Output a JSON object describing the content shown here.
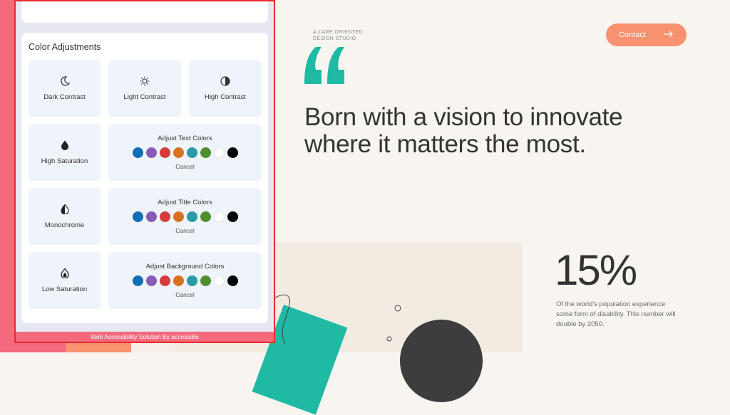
{
  "site": {
    "eyebrow_line1": "A CARE ORIENTED",
    "eyebrow_line2": "DESIGN STUDIO",
    "contact_label": "Contact",
    "headline_line1": "Born with a vision to innovate",
    "headline_line2": "where it matters the most.",
    "stat_value": "15%",
    "stat_text": "Of the world's population experience some form of disability. This number will double by 2050.",
    "colors": {
      "accent": "#f8916f",
      "teal": "#20b9a4",
      "pink": "#f36a7d",
      "text": "#333333"
    }
  },
  "panel": {
    "title": "Color Adjustments",
    "tiles": {
      "dark_contrast": {
        "label": "Dark Contrast",
        "icon": "moon-icon"
      },
      "light_contrast": {
        "label": "Light Contrast",
        "icon": "sun-icon"
      },
      "high_contrast": {
        "label": "High Contrast",
        "icon": "half-circle-icon"
      },
      "high_saturation": {
        "label": "High Saturation",
        "icon": "droplet-icon"
      },
      "monochrome": {
        "label": "Monochrome",
        "icon": "half-droplet-icon"
      },
      "low_saturation": {
        "label": "Low Saturation",
        "icon": "outline-droplet-icon"
      }
    },
    "color_groups": {
      "text": {
        "label": "Adjust Text Colors",
        "cancel": "Cancel"
      },
      "title": {
        "label": "Adjust Title Colors",
        "cancel": "Cancel"
      },
      "background": {
        "label": "Adjust Background Colors",
        "cancel": "Cancel"
      }
    },
    "palette": [
      "#0f6eb4",
      "#8a5bb3",
      "#d63a3a",
      "#d9721f",
      "#2a9aa5",
      "#4f8f2f",
      "#ffffff",
      "#000000"
    ],
    "footer": "Web Accessibility Solution By accessiBe"
  }
}
